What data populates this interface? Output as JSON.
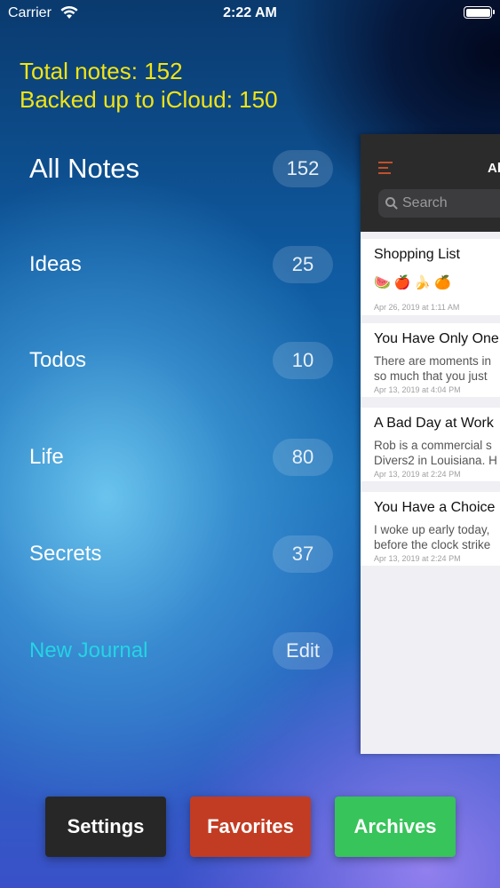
{
  "status_bar": {
    "carrier": "Carrier",
    "time": "2:22 AM"
  },
  "stats": {
    "total": "Total notes: 152",
    "backed_up": "Backed up to iCloud: 150"
  },
  "nav": {
    "items": [
      {
        "label": "All Notes",
        "count": "152"
      },
      {
        "label": "Ideas",
        "count": "25"
      },
      {
        "label": "Todos",
        "count": "10"
      },
      {
        "label": "Life",
        "count": "80"
      },
      {
        "label": "Secrets",
        "count": "37"
      }
    ],
    "new_journal": "New Journal",
    "edit": "Edit"
  },
  "preview": {
    "title": "All Notes",
    "search_placeholder": "Search",
    "notes": [
      {
        "title": "Shopping List",
        "body": "",
        "emoji": "🍉🍎🍌🍊",
        "date": "Apr 26, 2019 at 1:11 AM"
      },
      {
        "title": "You Have Only One",
        "body_lines": [
          "There are moments in",
          "so much that you just"
        ],
        "date": "Apr 13, 2019 at 4:04 PM"
      },
      {
        "title": "A Bad Day at Work",
        "body_lines": [
          "Rob is a commercial s",
          "Divers2 in Louisiana. H"
        ],
        "date": "Apr 13, 2019 at 2:24 PM"
      },
      {
        "title": "You Have a Choice",
        "body_lines": [
          "I woke up early today,",
          "before the clock strike"
        ],
        "date": "Apr 13, 2019 at 2:24 PM"
      }
    ]
  },
  "bottom_bar": {
    "settings": "Settings",
    "favorites": "Favorites",
    "archives": "Archives"
  },
  "colors": {
    "stats": "#f2e414",
    "accent": "#24d4e4",
    "settings": "#272727",
    "favorites": "#c23c23",
    "archives": "#37c45a",
    "menu_icon": "#c0512c"
  }
}
